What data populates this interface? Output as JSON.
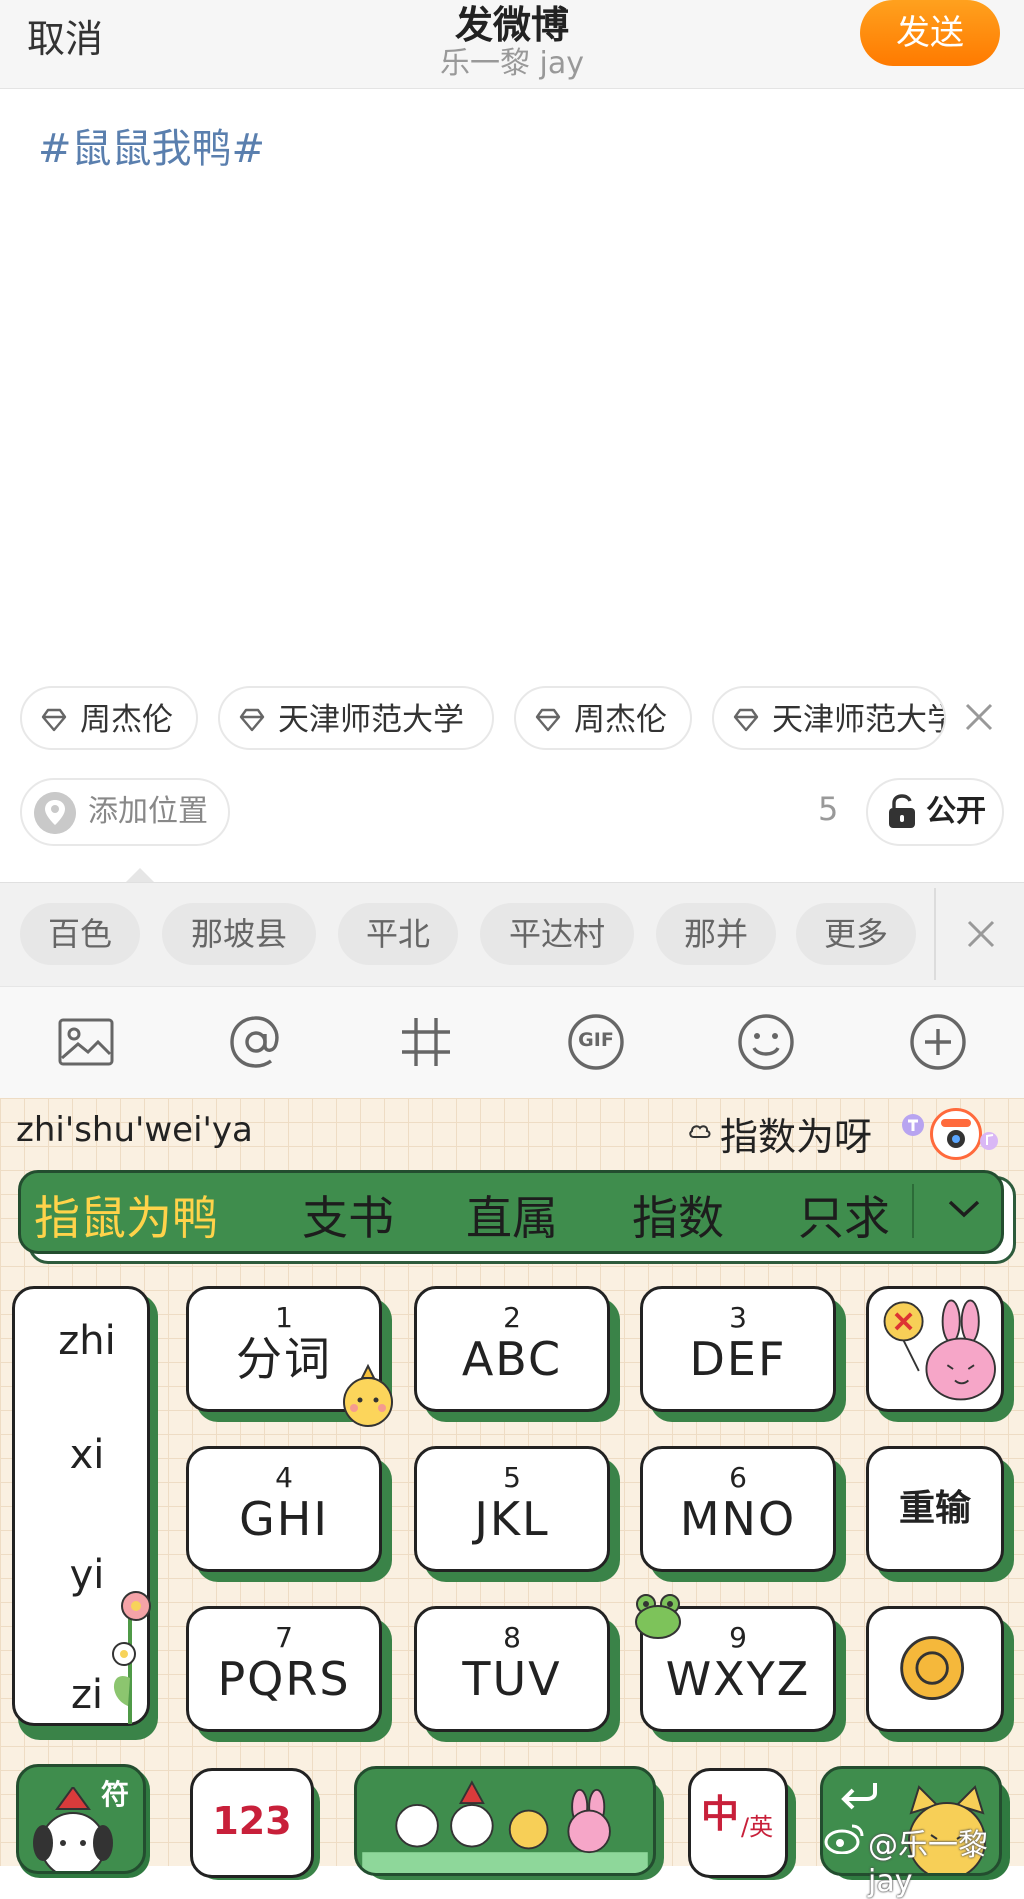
{
  "header": {
    "cancel_label": "取消",
    "title": "发微博",
    "subtitle": "乐一黎 jay",
    "send_label": "发送"
  },
  "compose": {
    "text": "#鼠鼠我鸭#"
  },
  "topics": {
    "chips": [
      "周杰伦",
      "天津师范大学",
      "周杰伦",
      "天津师范大学"
    ]
  },
  "location_row": {
    "add_location_label": "添加位置",
    "count": "5",
    "visibility_label": "公开"
  },
  "location_suggestions": {
    "items": [
      "百色",
      "那坡县",
      "平北",
      "平达村",
      "那并",
      "更多"
    ]
  },
  "toolbar": {
    "icons": [
      "image-icon",
      "at-icon",
      "hashtag-icon",
      "gif-icon",
      "emoji-icon",
      "plus-icon"
    ],
    "gif_label": "GIF"
  },
  "keyboard": {
    "pinyin": "zhi'shu'wei'ya",
    "prediction": "指数为呀",
    "candidates": [
      "指鼠为鸭",
      "支书",
      "直属",
      "指数",
      "只求"
    ],
    "left_column": [
      "zhi",
      "xi",
      "yi",
      "zi"
    ],
    "keys": [
      {
        "num": "1",
        "letters": "分词"
      },
      {
        "num": "2",
        "letters": "ABC"
      },
      {
        "num": "3",
        "letters": "DEF"
      },
      {
        "num": "4",
        "letters": "GHI"
      },
      {
        "num": "5",
        "letters": "JKL"
      },
      {
        "num": "6",
        "letters": "MNO"
      },
      {
        "num": "7",
        "letters": "PQRS"
      },
      {
        "num": "8",
        "letters": "TUV"
      },
      {
        "num": "9",
        "letters": "WXYZ"
      }
    ],
    "retype_label": "重输",
    "symbol_label": "符",
    "numbers_label": "123",
    "lang_zh": "中",
    "lang_en": "/英",
    "accent_green": "#3f8d4d",
    "candidate_highlight": "#ffd34a"
  },
  "watermark": "@乐一黎jay"
}
